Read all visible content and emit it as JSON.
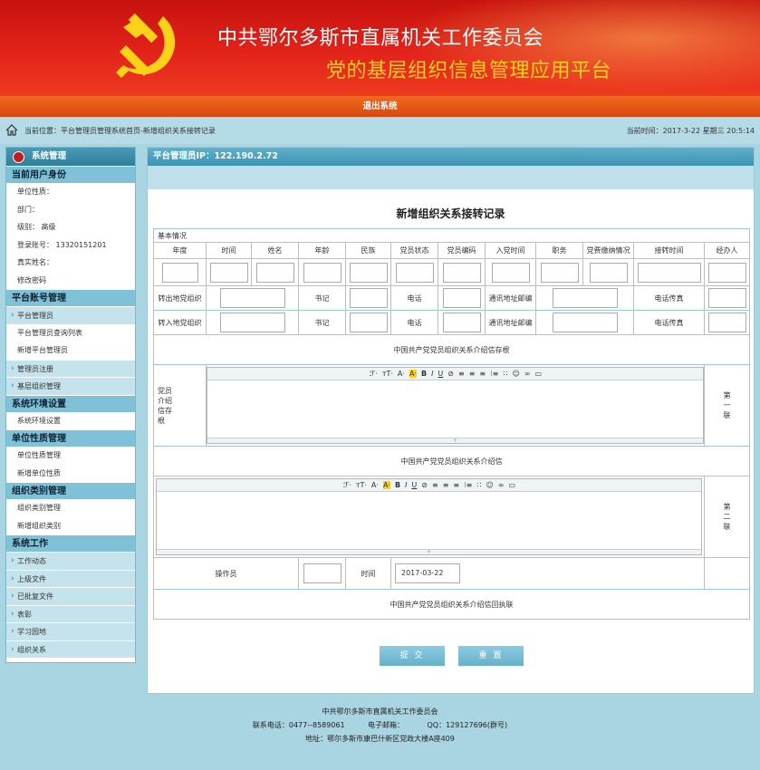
{
  "header": {
    "title_line1": "中共鄂尔多斯市直属机关工作委员会",
    "title_line2": "党的基层组织信息管理应用平台",
    "logout": "退出系统"
  },
  "breadcrumb": {
    "label": "当前位置：平台管理员管理系统首页-新增组织关系接转记录",
    "clock": "当前时间：2017-3-22 星期三 20:5:14"
  },
  "sidebar": {
    "system_title": "系统管理",
    "sections": [
      {
        "title": "当前用户身份",
        "items": [
          {
            "label": "单位性质：",
            "arrow": false
          },
          {
            "label": "部门：",
            "arrow": false
          },
          {
            "label": "级别： 高级",
            "arrow": false
          },
          {
            "label": "登录账号： 13320151201",
            "arrow": false
          },
          {
            "label": "真实姓名：",
            "arrow": false
          },
          {
            "label": "修改密码",
            "arrow": false
          }
        ]
      },
      {
        "title": "平台账号管理",
        "items": [
          {
            "label": "平台管理员",
            "arrow": true
          },
          {
            "label": "平台管理员查询列表",
            "arrow": false
          },
          {
            "label": "新增平台管理员",
            "arrow": false
          },
          {
            "label": "管理员注册",
            "arrow": true
          },
          {
            "label": "基层组织管理",
            "arrow": true
          }
        ]
      },
      {
        "title": "系统环境设置",
        "items": [
          {
            "label": "系统环境设置",
            "arrow": false
          }
        ]
      },
      {
        "title": "单位性质管理",
        "items": [
          {
            "label": "单位性质管理",
            "arrow": false
          },
          {
            "label": "新增单位性质",
            "arrow": false
          }
        ]
      },
      {
        "title": "组织类别管理",
        "items": [
          {
            "label": "组织类别管理",
            "arrow": false
          },
          {
            "label": "新增组织类别",
            "arrow": false
          }
        ]
      },
      {
        "title": "系统工作",
        "items": [
          {
            "label": "工作动态",
            "arrow": true
          },
          {
            "label": "上级文件",
            "arrow": true
          },
          {
            "label": "已批复文件",
            "arrow": true
          },
          {
            "label": "表彰",
            "arrow": true
          },
          {
            "label": "学习园地",
            "arrow": true
          },
          {
            "label": "组织关系",
            "arrow": true
          }
        ]
      }
    ]
  },
  "main": {
    "ip_label": "平台管理员IP：122.190.2.72",
    "form_title": "新增组织关系接转记录",
    "basic_info": "基本情况",
    "columns": [
      "年度",
      "时间",
      "姓名",
      "年龄",
      "民族",
      "党员状态",
      "党员编码",
      "入党时间",
      "职务",
      "党费缴纳情况",
      "接转时间",
      "经办人"
    ],
    "out_org": "转出地党组织",
    "in_org": "转入地党组织",
    "secretary": "书记",
    "phone": "电话",
    "postal": "通讯地址邮编",
    "fax": "电话传真",
    "stub_heading": "中国共产党党员组织关系介绍信存根",
    "stub_side_label": "党员介绍信存根",
    "first_copy": "第一联",
    "letter_heading": "中国共产党党员组织关系介绍信",
    "second_copy": "第二联",
    "operator": "操作员",
    "time_label": "时间",
    "date_value": "2017-03-22",
    "receipt_heading": "中国共产党党员组织关系介绍信回执联",
    "toolbar": [
      "ℱ·",
      "тT·",
      "A·",
      "A·",
      "B",
      "I",
      "U",
      "⊘",
      "≡",
      "≡",
      "≡",
      "⁝≡",
      "∷",
      "☺",
      "∞",
      "▭"
    ],
    "submit": "提 交",
    "reset": "重 置"
  },
  "footer": {
    "line1": "中共鄂尔多斯市直属机关工作委员会",
    "line2": "联系电话：0477--8589061          电子邮箱：          QQ：129127696(群号)",
    "line3": "地址：鄂尔多斯市康巴什新区党政大楼A座409"
  },
  "colors": {
    "header_red": "#e2231a",
    "gold": "#ffd21a",
    "accent_blue": "#3c93b2"
  }
}
